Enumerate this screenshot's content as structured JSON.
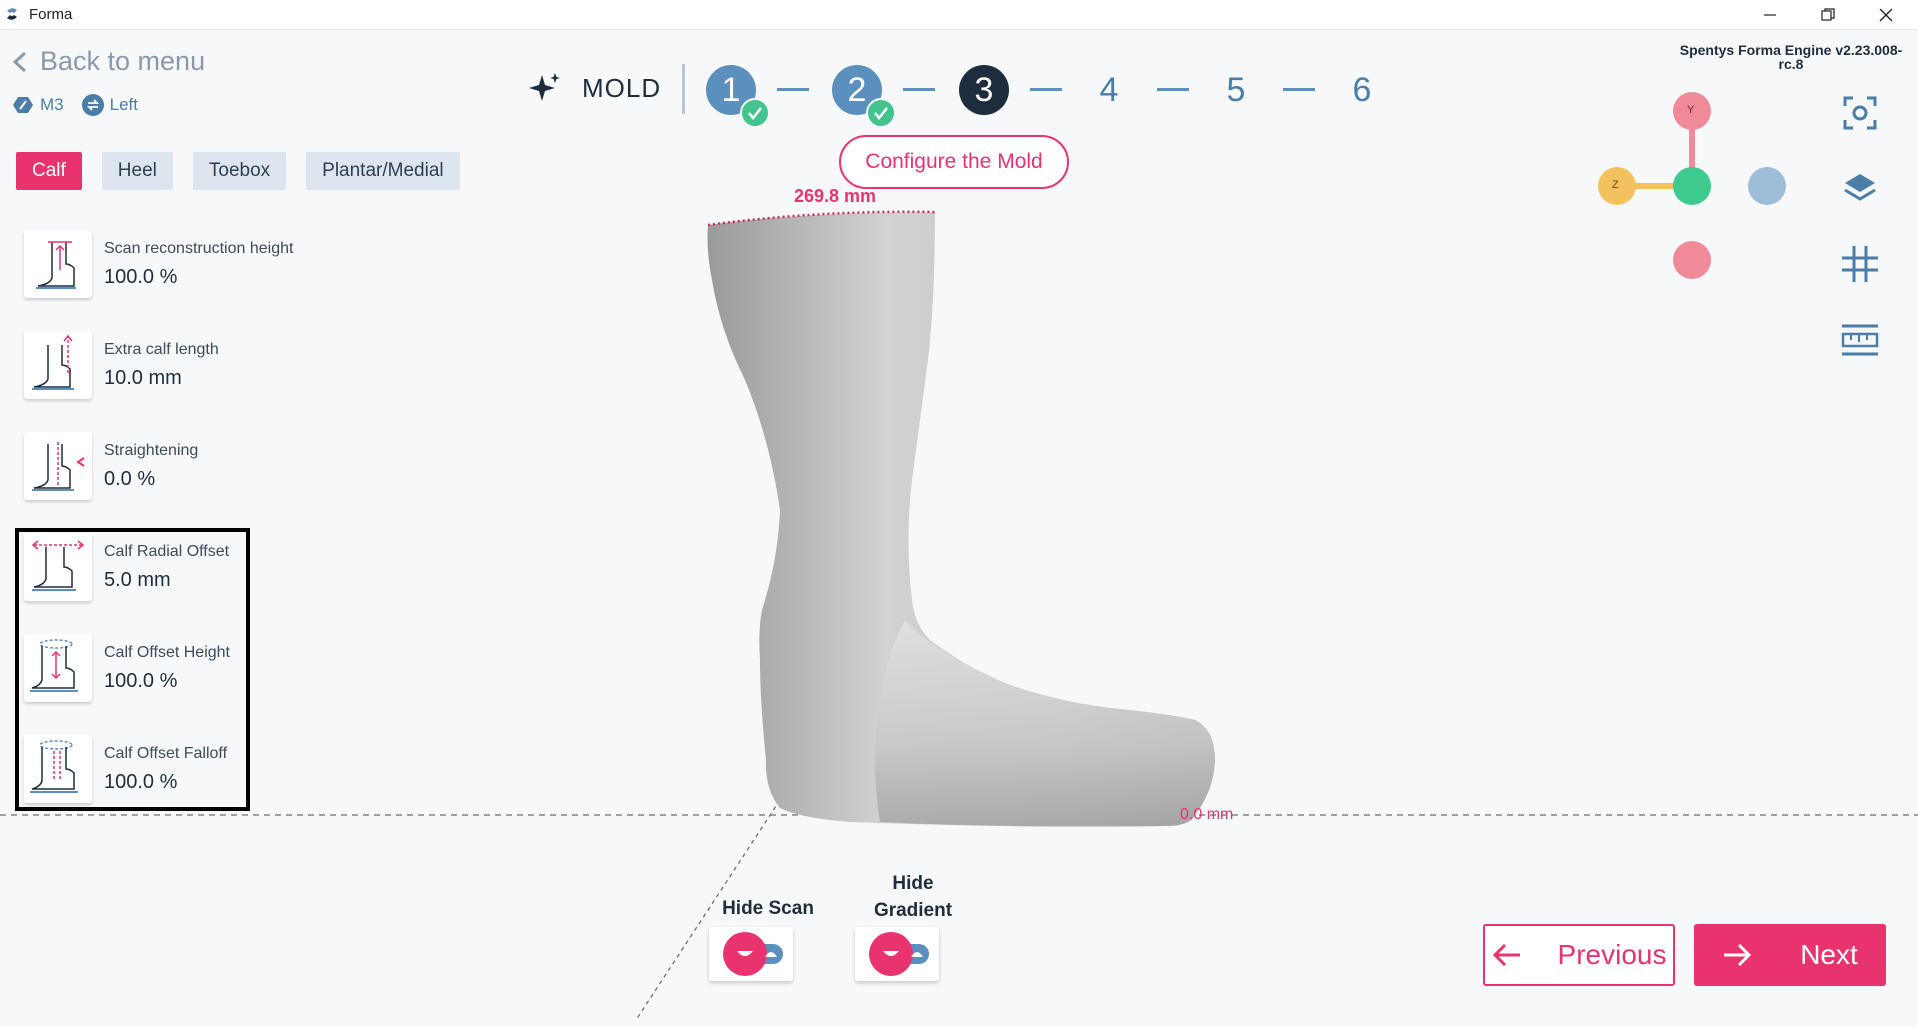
{
  "window": {
    "title": "Forma"
  },
  "nav": {
    "back_label": "Back to menu",
    "model_chip": "M3",
    "side_chip": "Left"
  },
  "tabs": [
    {
      "label": "Calf",
      "active": true
    },
    {
      "label": "Heel",
      "active": false
    },
    {
      "label": "Toebox",
      "active": false
    },
    {
      "label": "Plantar/Medial",
      "active": false
    }
  ],
  "params": [
    {
      "label": "Scan reconstruction height",
      "value": "100.0 %"
    },
    {
      "label": "Extra calf length",
      "value": "10.0 mm"
    },
    {
      "label": "Straightening",
      "value": "0.0 %"
    },
    {
      "label": "Calf Radial Offset",
      "value": "5.0 mm"
    },
    {
      "label": "Calf Offset Height",
      "value": "100.0 %"
    },
    {
      "label": "Calf Offset Falloff",
      "value": "100.0 %"
    }
  ],
  "stepper": {
    "section_label": "MOLD",
    "steps": [
      {
        "number": "1",
        "state": "done"
      },
      {
        "number": "2",
        "state": "done"
      },
      {
        "number": "3",
        "state": "current"
      },
      {
        "number": "4",
        "state": "todo"
      },
      {
        "number": "5",
        "state": "todo"
      },
      {
        "number": "6",
        "state": "todo"
      }
    ],
    "tooltip": "Configure the Mold"
  },
  "engine_version": "Spentys Forma Engine v2.23.008-rc.8",
  "viewport": {
    "top_measure": "269.8 mm",
    "ground_measure": "0.0 mm",
    "axis_labels": {
      "y": "Y",
      "z": "Z"
    }
  },
  "toggles": {
    "hide_scan": "Hide Scan",
    "hide_gradient": "Hide Gradient"
  },
  "footer": {
    "previous_label": "Previous",
    "next_label": "Next"
  },
  "colors": {
    "accent": "#e8336f",
    "primary": "#5b8fbd",
    "dark": "#1e2d3d",
    "success": "#43c48e"
  }
}
